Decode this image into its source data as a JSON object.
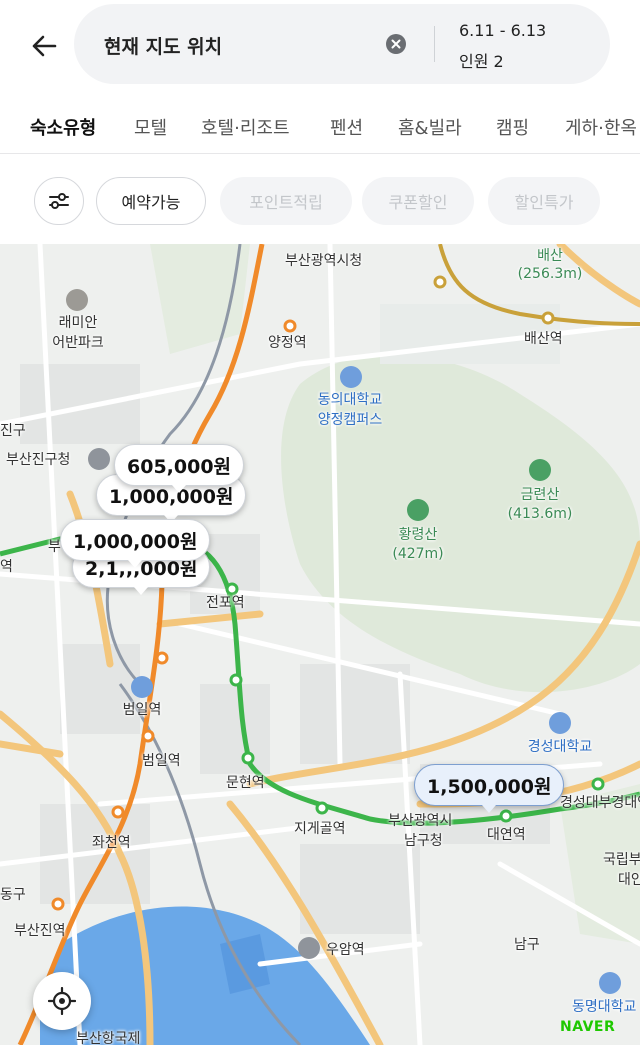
{
  "search": {
    "location": "현재 지도 위치",
    "dates": "6.11 - 6.13",
    "guests": "인원 2"
  },
  "tabs": [
    {
      "label": "숙소유형",
      "active": true
    },
    {
      "label": "모텔"
    },
    {
      "label": "호텔·리조트"
    },
    {
      "label": "펜션"
    },
    {
      "label": "홈&빌라"
    },
    {
      "label": "캠핑"
    },
    {
      "label": "게하·한옥"
    }
  ],
  "filters": {
    "chips": [
      {
        "label": "예약가능",
        "enabled": true
      },
      {
        "label": "포인트적립",
        "enabled": false
      },
      {
        "label": "쿠폰할인",
        "enabled": false
      },
      {
        "label": "할인특가",
        "enabled": false
      }
    ]
  },
  "map": {
    "places": {
      "busan_city_hall": "부산광역시청",
      "baesan": "배산",
      "baesan_elev": "(256.3m)",
      "baesan_station": "배산역",
      "raemian": "래미안",
      "raemian2": "어반파크",
      "yangjeong": "양정역",
      "dongeui": "동의대학교",
      "dongeui2": "양정캠퍼스",
      "jingu": "진구",
      "busanjingu_office": "부산진구청",
      "geumryeonsan": "금련산",
      "geumryeonsan_elev": "(413.6m)",
      "hwangryeongsan": "황령산",
      "hwangryeongsan_elev": "(427m)",
      "jeonpo": "전포역",
      "beomil_station_icon": "범일역",
      "beomil": "범일역",
      "munhyeon": "문현역",
      "kyungsung": "경성대학교",
      "kyungsung_pknu": "경성대부경대역",
      "jigegol": "지게골역",
      "namgu_office_1": "부산광역시",
      "namgu_office_2": "남구청",
      "daeyeon": "대연역",
      "pknu": "국립부",
      "pknu2": "대인",
      "jwacheon": "좌천역",
      "donggu": "동구",
      "busanjin": "부산진역",
      "uam": "우암역",
      "namgu": "남구",
      "tongmyong": "동명대학교",
      "busan_port": "부산항국제",
      "bu_partial": "부",
      "yeok_partial": "역"
    },
    "prices": [
      {
        "label": "605,000원"
      },
      {
        "label": "1,000,000원"
      },
      {
        "label": "1,000,000원"
      },
      {
        "label": "2,1,,,000원"
      },
      {
        "label": "1,500,000원",
        "selected": true
      }
    ],
    "brand": "NAVER"
  },
  "icons": {
    "back": "back-arrow-icon",
    "clear": "clear-icon",
    "filter": "filter-sliders-icon",
    "locate": "current-location-icon"
  },
  "colors": {
    "subway_green": "#3cb54a",
    "subway_orange": "#f08a2a",
    "road": "#f3c67c",
    "sea": "#6aa8e8",
    "mountain": "#dde8d9",
    "naver": "#1ec800"
  }
}
